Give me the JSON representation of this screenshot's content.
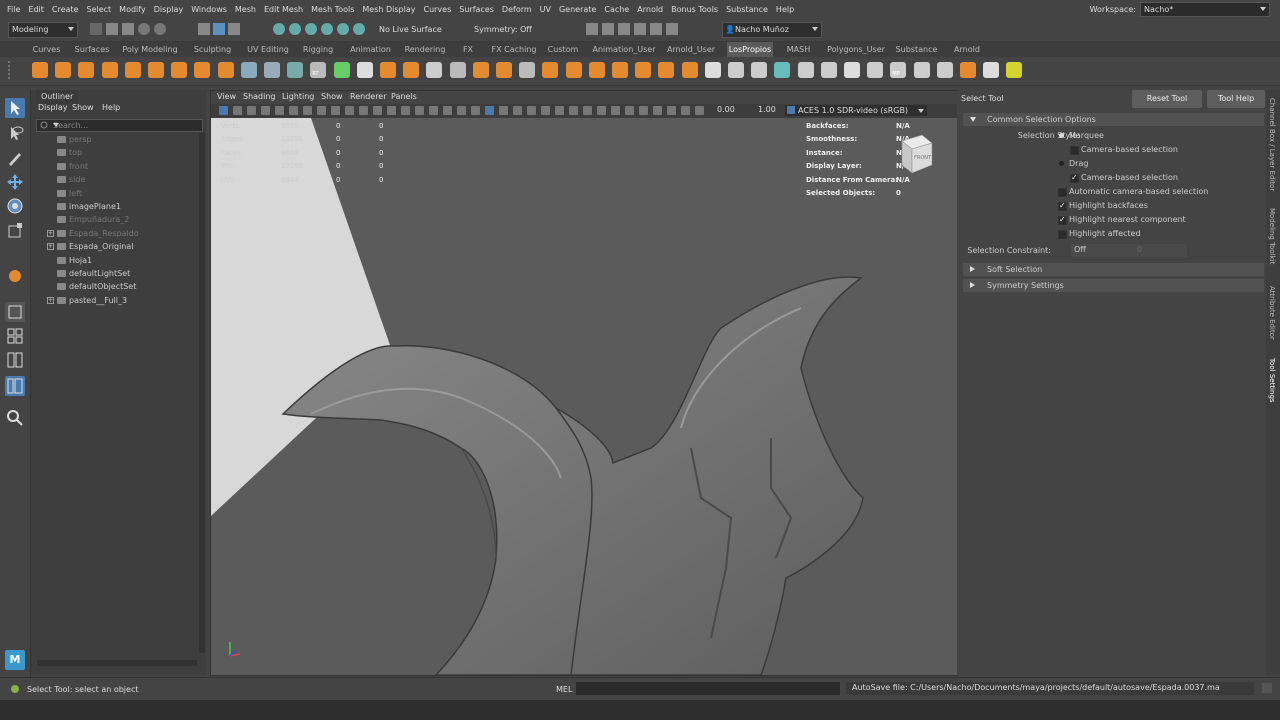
{
  "menubar": {
    "items": [
      "File",
      "Edit",
      "Create",
      "Select",
      "Modify",
      "Display",
      "Windows",
      "Mesh",
      "Edit Mesh",
      "Mesh Tools",
      "Mesh Display",
      "Curves",
      "Surfaces",
      "Deform",
      "UV",
      "Generate",
      "Cache",
      "Arnold",
      "Bonus Tools",
      "Substance",
      "Help"
    ],
    "workspace_label": "Workspace:",
    "workspace_value": "Nacho*"
  },
  "statusline": {
    "mode": "Modeling",
    "live_surface": "No Live Surface",
    "symmetry": "Symmetry: Off",
    "user": "Nacho Muñoz"
  },
  "shelf": {
    "tabs": [
      "Curves",
      "Surfaces",
      "Poly Modeling",
      "Sculpting",
      "UV Editing",
      "Rigging",
      "Animation",
      "Rendering",
      "FX",
      "FX Caching",
      "Custom",
      "Animation_User",
      "Arnold_User",
      "LosPropios",
      "MASH",
      "Polygons_User",
      "Substance",
      "Arnold"
    ],
    "active_tab": "LosPropios",
    "icon_labels": [
      "RT",
      "MP"
    ]
  },
  "outliner": {
    "title": "Outliner",
    "menu": [
      "Display",
      "Show",
      "Help"
    ],
    "search_placeholder": "Search...",
    "items": [
      {
        "label": "persp",
        "dim": true,
        "expand": ""
      },
      {
        "label": "top",
        "dim": true,
        "expand": ""
      },
      {
        "label": "front",
        "dim": true,
        "expand": ""
      },
      {
        "label": "side",
        "dim": true,
        "expand": ""
      },
      {
        "label": "left",
        "dim": true,
        "expand": ""
      },
      {
        "label": "imagePlane1",
        "dim": false,
        "expand": ""
      },
      {
        "label": "Empuñadura_2",
        "dim": true,
        "expand": ""
      },
      {
        "label": "Espada_Respaldo",
        "dim": true,
        "expand": "+"
      },
      {
        "label": "Espada_Original",
        "dim": false,
        "expand": "+"
      },
      {
        "label": "Hoja1",
        "dim": false,
        "expand": ""
      },
      {
        "label": "defaultLightSet",
        "dim": false,
        "expand": ""
      },
      {
        "label": "defaultObjectSet",
        "dim": false,
        "expand": ""
      },
      {
        "label": "pasted__Full_3",
        "dim": false,
        "expand": "+"
      }
    ]
  },
  "viewport": {
    "menu": [
      "View",
      "Shading",
      "Lighting",
      "Show",
      "Renderer",
      "Panels"
    ],
    "exposure": "0.00",
    "gamma": "1.00",
    "color_space": "ACES 1.0 SDR-video (sRGB)",
    "stats": [
      {
        "label": "Verts:",
        "v1": "6650",
        "v2": "0",
        "v3": "0"
      },
      {
        "label": "Edges:",
        "v1": "13296",
        "v2": "0",
        "v3": "0"
      },
      {
        "label": "Faces:",
        "v1": "6648",
        "v2": "0",
        "v3": "0"
      },
      {
        "label": "Tris:",
        "v1": "13296",
        "v2": "0",
        "v3": "0"
      },
      {
        "label": "UVs:",
        "v1": "6844",
        "v2": "0",
        "v3": "0"
      }
    ],
    "info": [
      {
        "label": "Backfaces:",
        "value": "N/A"
      },
      {
        "label": "Smoothness:",
        "value": "N/A"
      },
      {
        "label": "Instance:",
        "value": "N/A"
      },
      {
        "label": "Display Layer:",
        "value": "N/A"
      },
      {
        "label": "Distance From Camera:",
        "value": "N/A"
      },
      {
        "label": "Selected Objects:",
        "value": "0"
      }
    ],
    "viewcube_label": "FRONT",
    "camera": "persp"
  },
  "tool_settings": {
    "title": "Select Tool",
    "reset_button": "Reset Tool",
    "help_button": "Tool Help",
    "section_common": "Common Selection Options",
    "selection_style_label": "Selection Style:",
    "marquee": "Marquee",
    "camera_based_1": "Camera-based selection",
    "drag": "Drag",
    "camera_based_2": "Camera-based selection",
    "auto_camera": "Automatic camera-based selection",
    "highlight_backfaces": "Highlight backfaces",
    "highlight_nearest": "Highlight nearest component",
    "highlight_affected": "Highlight affected",
    "constraint_label": "Selection Constraint:",
    "constraint_value": "Off",
    "constraint_num": "0",
    "section_soft": "Soft Selection",
    "section_symmetry": "Symmetry Settings"
  },
  "side_tabs": [
    "Channel Box / Layer Editor",
    "Modeling Toolkit",
    "Attribute Editor",
    "Tool Settings"
  ],
  "bottom": {
    "help_text": "Select Tool: select an object",
    "mel_label": "MEL",
    "autosave": "AutoSave file: C:/Users/Nacho/Documents/maya/projects/default/autosave/Espada.0037.ma"
  },
  "colors": {
    "accent": "#5d9ee0",
    "shelf_orange": "#e48a2f",
    "select_blue": "#4a7bb0"
  }
}
